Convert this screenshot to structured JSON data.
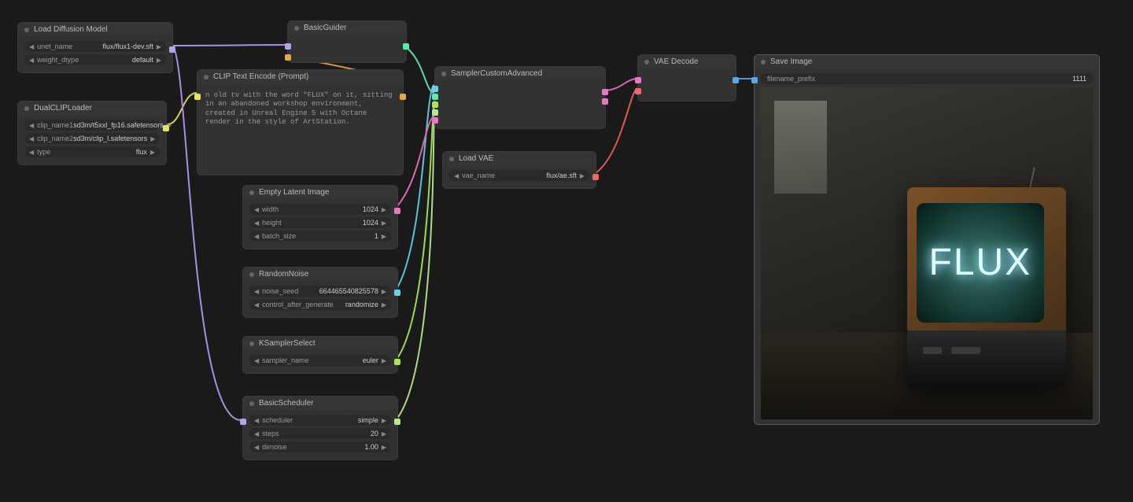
{
  "nodes": {
    "loadDiffusion": {
      "title": "Load Diffusion Model",
      "unet_name": {
        "label": "unet_name",
        "value": "flux/flux1-dev.sft"
      },
      "weight_dtype": {
        "label": "weight_dtype",
        "value": "default"
      }
    },
    "dualClip": {
      "title": "DualCLIPLoader",
      "clip_name1": {
        "label": "clip_name1",
        "value": "sd3m/t5xxl_fp16.safetensors"
      },
      "clip_name2": {
        "label": "clip_name2",
        "value": "sd3m/clip_l.safetensors"
      },
      "type": {
        "label": "type",
        "value": "flux"
      }
    },
    "clipText": {
      "title": "CLIP Text Encode (Prompt)",
      "prompt_before": "n old tv with the word \"",
      "prompt_word": "FLUX",
      "prompt_after": "\" on it, sitting in an abandoned workshop environment, created in Unreal Engine 5 with Octane render in the style of ArtStation."
    },
    "basicGuider": {
      "title": "BasicGuider"
    },
    "emptyLatent": {
      "title": "Empty Latent Image",
      "width": {
        "label": "width",
        "value": "1024"
      },
      "height": {
        "label": "height",
        "value": "1024"
      },
      "batch": {
        "label": "batch_size",
        "value": "1"
      }
    },
    "randomNoise": {
      "title": "RandomNoise",
      "seed": {
        "label": "noise_seed",
        "value": "664465540825578"
      },
      "ctrl": {
        "label": "control_after_generate",
        "value": "randomize"
      }
    },
    "ksampler": {
      "title": "KSamplerSelect",
      "sampler": {
        "label": "sampler_name",
        "value": "euler"
      }
    },
    "basicScheduler": {
      "title": "BasicScheduler",
      "scheduler": {
        "label": "scheduler",
        "value": "simple"
      },
      "steps": {
        "label": "steps",
        "value": "20"
      },
      "denoise": {
        "label": "denoise",
        "value": "1.00"
      }
    },
    "samplerCustom": {
      "title": "SamplerCustomAdvanced"
    },
    "loadVae": {
      "title": "Load VAE",
      "vae": {
        "label": "vae_name",
        "value": "flux/ae.sft"
      }
    },
    "vaeDecode": {
      "title": "VAE Decode"
    },
    "saveImage": {
      "title": "Save Image",
      "prefix": {
        "label": "filename_prefix",
        "value": "1111"
      },
      "screen_text": "FLUX"
    }
  },
  "triangles": {
    "left": "◀",
    "right": "▶"
  }
}
